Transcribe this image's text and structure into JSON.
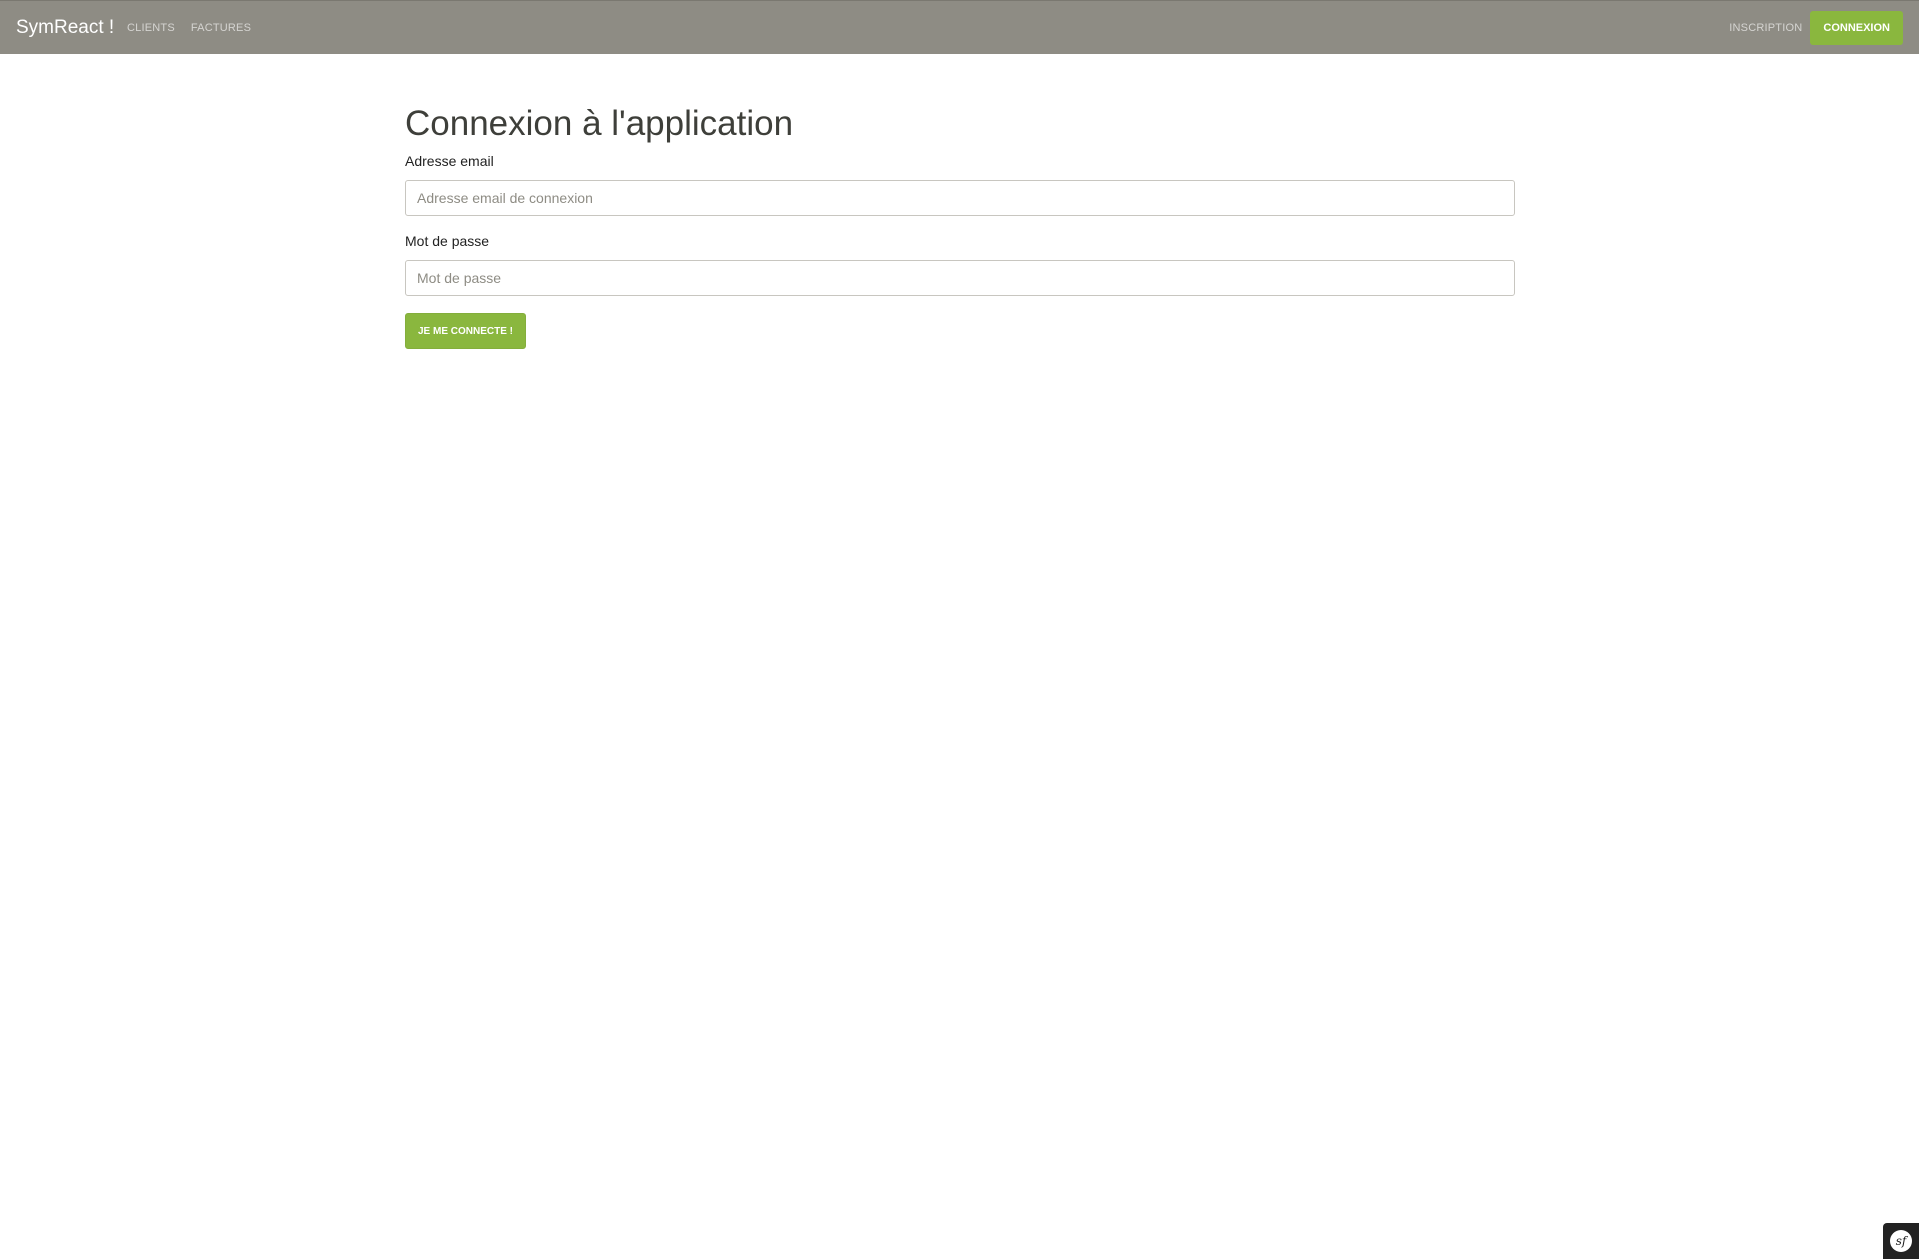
{
  "navbar": {
    "brand": "SymReact !",
    "left_links": [
      {
        "label": "CLIENTS"
      },
      {
        "label": "FACTURES"
      }
    ],
    "right_links": {
      "signup_label": "INSCRIPTION",
      "login_label": "CONNEXION"
    }
  },
  "main": {
    "title": "Connexion à l'application",
    "email": {
      "label": "Adresse email",
      "placeholder": "Adresse email de connexion",
      "value": ""
    },
    "password": {
      "label": "Mot de passe",
      "placeholder": "Mot de passe",
      "value": ""
    },
    "submit_label": "JE ME CONNECTE !"
  },
  "debug_toolbar": {
    "icon": "symfony-logo-icon",
    "glyph": "sf"
  },
  "colors": {
    "navbar_bg": "#8e8c84",
    "success": "#8ab73e",
    "text": "#3e3f3a"
  }
}
